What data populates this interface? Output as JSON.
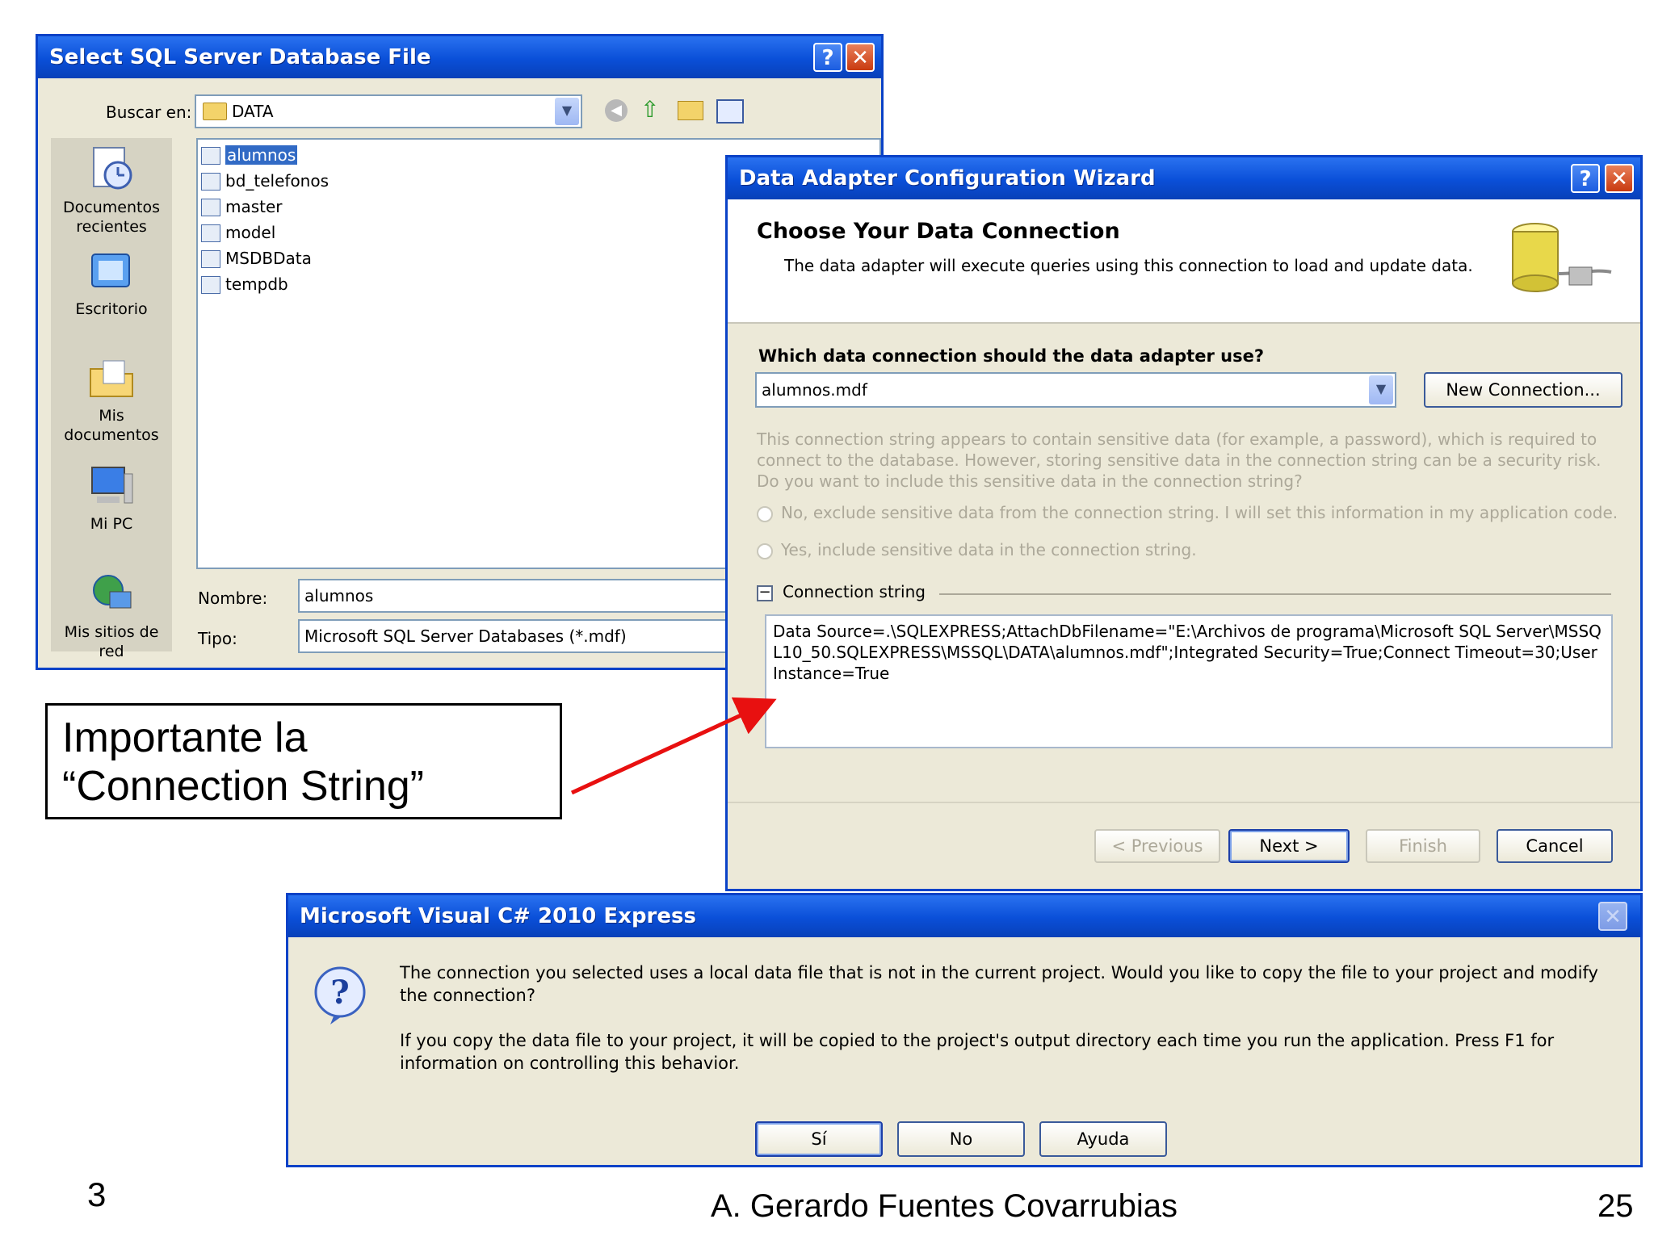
{
  "file_dialog": {
    "title": "Select SQL Server Database File",
    "look_in_label": "Buscar en:",
    "look_in_value": "DATA",
    "places": [
      "Documentos recientes",
      "Escritorio",
      "Mis documentos",
      "Mi PC",
      "Mis sitios de red"
    ],
    "files": [
      "alumnos",
      "bd_telefonos",
      "master",
      "model",
      "MSDBData",
      "tempdb"
    ],
    "selected_file": "alumnos",
    "name_label": "Nombre:",
    "name_value": "alumnos",
    "type_label": "Tipo:",
    "type_value": "Microsoft SQL Server Databases (*.mdf)"
  },
  "wizard": {
    "title": "Data Adapter Configuration Wizard",
    "heading": "Choose Your Data Connection",
    "subheading": "The data adapter will execute queries using this connection to load and update data.",
    "question": "Which data connection should the data adapter use?",
    "connection_value": "alumnos.mdf",
    "new_connection_label": "New Connection...",
    "sensitive_text": "This connection string appears to contain sensitive data (for example, a password), which is required to connect to the database. However, storing sensitive data in the connection string can be a security risk. Do you want to include this sensitive data in the connection string?",
    "radio_no": "No, exclude sensitive data from the connection string. I will set this information in my application code.",
    "radio_yes": "Yes, include sensitive data in the connection string.",
    "connection_string_label": "Connection string",
    "connection_string_value": "Data Source=.\\SQLEXPRESS;AttachDbFilename=\"E:\\Archivos de programa\\Microsoft SQL Server\\MSSQL10_50.SQLEXPRESS\\MSSQL\\DATA\\alumnos.mdf\";Integrated Security=True;Connect Timeout=30;User Instance=True",
    "buttons": {
      "previous": "< Previous",
      "next": "Next >",
      "finish": "Finish",
      "cancel": "Cancel"
    }
  },
  "msgbox": {
    "title": "Microsoft Visual C# 2010 Express",
    "message1": "The connection you selected uses a local data file that is not in the current project. Would you like to copy the file to your project and modify the connection?",
    "message2": "If you copy the data file to your project, it will be copied to the project's output directory each time you run the application. Press F1 for information on controlling this behavior.",
    "buttons": {
      "yes": "Sí",
      "no": "No",
      "help": "Ayuda"
    }
  },
  "callout": {
    "text": "Importante la “Connection String”"
  },
  "footer": {
    "chapter": "3",
    "author": "A. Gerardo Fuentes Covarrubias",
    "page": "25"
  },
  "colors": {
    "titlebar": "#0a4fd8",
    "window_bg": "#ece9d8",
    "arrow": "#e81010",
    "selection": "#316ac5"
  }
}
